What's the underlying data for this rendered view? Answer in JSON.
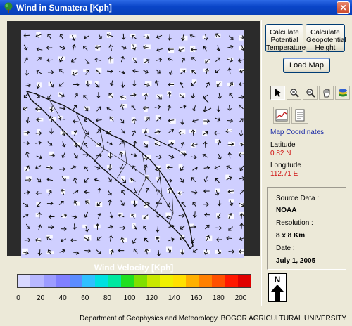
{
  "window": {
    "title": "Wind in Sumatera [Kph]"
  },
  "buttons": {
    "calc_temp": "Calculate Potential Temperature",
    "calc_geo": "Calculate Geopotential Height",
    "load_map": "Load Map"
  },
  "toolbar": {
    "tools": [
      "pointer-icon",
      "zoom-in-icon",
      "zoom-out-icon",
      "pan-hand-icon",
      "layers-icon"
    ]
  },
  "coords": {
    "heading": "Map Coordinates",
    "lat_label": "Latitude",
    "lat_value": "0.82  N",
    "lon_label": "Longitude",
    "lon_value": "112.71  E"
  },
  "info": {
    "source_label": "Source Data :",
    "source_value": "NOAA",
    "res_label": "Resolution :",
    "res_value": "8 x 8 Km",
    "date_label": "Date :",
    "date_value": "July 1, 2005"
  },
  "legend": {
    "title": "Wind Velocity [Kph]",
    "ticks": [
      "0",
      "20",
      "40",
      "60",
      "80",
      "100",
      "120",
      "140",
      "160",
      "180",
      "200"
    ],
    "colors": [
      "#d8d8ff",
      "#b8b8ff",
      "#9c9cff",
      "#8080ff",
      "#5c8cff",
      "#30c0ff",
      "#00e0e0",
      "#00e8a0",
      "#20e020",
      "#80e000",
      "#c8e800",
      "#f0f000",
      "#ffe000",
      "#ffb000",
      "#ff8000",
      "#ff5000",
      "#ff1800",
      "#e00000"
    ],
    "map_fill": "#cfcfff"
  },
  "north": {
    "label": "N"
  },
  "status": {
    "text": "Department of Geophysics and Meteorology, BOGOR AGRICULTURAL UNIVERSITY"
  }
}
